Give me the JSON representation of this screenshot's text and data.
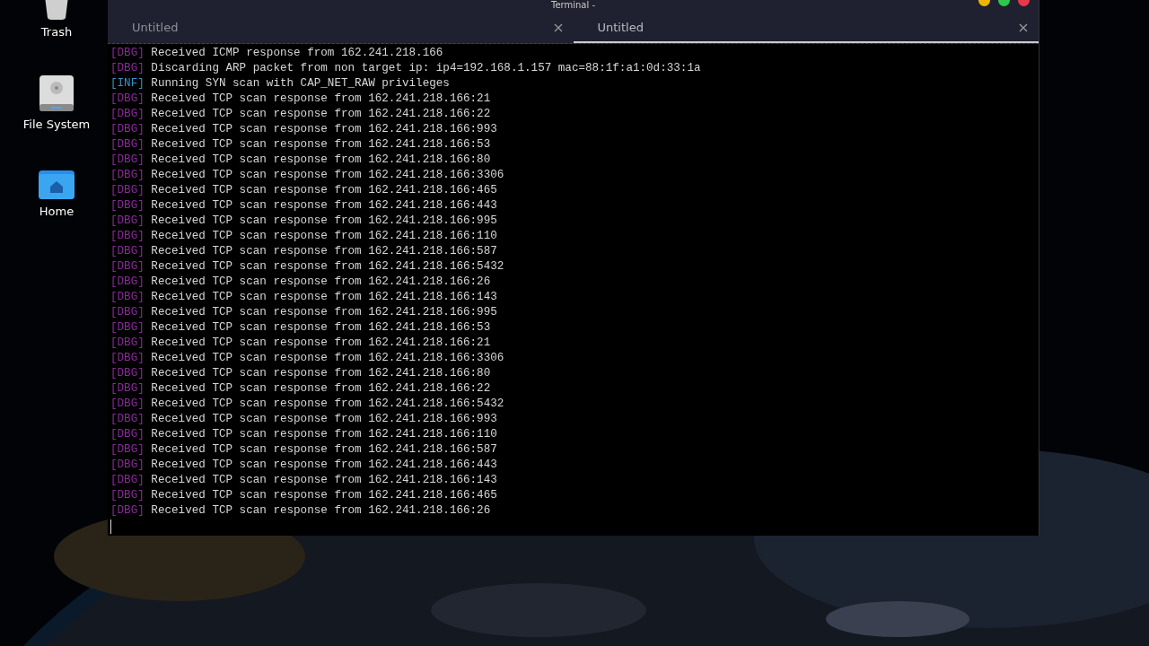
{
  "desktop_icons": [
    {
      "kind": "trash",
      "label": "Trash"
    },
    {
      "kind": "drive",
      "label": "File System"
    },
    {
      "kind": "home",
      "label": "Home"
    }
  ],
  "window": {
    "title": "Terminal -",
    "tabs": [
      {
        "label": "Untitled",
        "selected": false
      },
      {
        "label": "Untitled",
        "selected": true
      }
    ],
    "lines": [
      {
        "kind": "dbg",
        "tag": "[DBG]",
        "text": "Received ICMP response from 162.241.218.166"
      },
      {
        "kind": "dbg",
        "tag": "[DBG]",
        "text": "Discarding ARP packet from non target ip: ip4=192.168.1.157 mac=88:1f:a1:0d:33:1a"
      },
      {
        "kind": "inf",
        "tag": "[INF]",
        "text": "Running SYN scan with CAP_NET_RAW privileges"
      },
      {
        "kind": "dbg",
        "tag": "[DBG]",
        "text": "Received TCP scan response from 162.241.218.166:21"
      },
      {
        "kind": "dbg",
        "tag": "[DBG]",
        "text": "Received TCP scan response from 162.241.218.166:22"
      },
      {
        "kind": "dbg",
        "tag": "[DBG]",
        "text": "Received TCP scan response from 162.241.218.166:993"
      },
      {
        "kind": "dbg",
        "tag": "[DBG]",
        "text": "Received TCP scan response from 162.241.218.166:53"
      },
      {
        "kind": "dbg",
        "tag": "[DBG]",
        "text": "Received TCP scan response from 162.241.218.166:80"
      },
      {
        "kind": "dbg",
        "tag": "[DBG]",
        "text": "Received TCP scan response from 162.241.218.166:3306"
      },
      {
        "kind": "dbg",
        "tag": "[DBG]",
        "text": "Received TCP scan response from 162.241.218.166:465"
      },
      {
        "kind": "dbg",
        "tag": "[DBG]",
        "text": "Received TCP scan response from 162.241.218.166:443"
      },
      {
        "kind": "dbg",
        "tag": "[DBG]",
        "text": "Received TCP scan response from 162.241.218.166:995"
      },
      {
        "kind": "dbg",
        "tag": "[DBG]",
        "text": "Received TCP scan response from 162.241.218.166:110"
      },
      {
        "kind": "dbg",
        "tag": "[DBG]",
        "text": "Received TCP scan response from 162.241.218.166:587"
      },
      {
        "kind": "dbg",
        "tag": "[DBG]",
        "text": "Received TCP scan response from 162.241.218.166:5432"
      },
      {
        "kind": "dbg",
        "tag": "[DBG]",
        "text": "Received TCP scan response from 162.241.218.166:26"
      },
      {
        "kind": "dbg",
        "tag": "[DBG]",
        "text": "Received TCP scan response from 162.241.218.166:143"
      },
      {
        "kind": "dbg",
        "tag": "[DBG]",
        "text": "Received TCP scan response from 162.241.218.166:995"
      },
      {
        "kind": "dbg",
        "tag": "[DBG]",
        "text": "Received TCP scan response from 162.241.218.166:53"
      },
      {
        "kind": "dbg",
        "tag": "[DBG]",
        "text": "Received TCP scan response from 162.241.218.166:21"
      },
      {
        "kind": "dbg",
        "tag": "[DBG]",
        "text": "Received TCP scan response from 162.241.218.166:3306"
      },
      {
        "kind": "dbg",
        "tag": "[DBG]",
        "text": "Received TCP scan response from 162.241.218.166:80"
      },
      {
        "kind": "dbg",
        "tag": "[DBG]",
        "text": "Received TCP scan response from 162.241.218.166:22"
      },
      {
        "kind": "dbg",
        "tag": "[DBG]",
        "text": "Received TCP scan response from 162.241.218.166:5432"
      },
      {
        "kind": "dbg",
        "tag": "[DBG]",
        "text": "Received TCP scan response from 162.241.218.166:993"
      },
      {
        "kind": "dbg",
        "tag": "[DBG]",
        "text": "Received TCP scan response from 162.241.218.166:110"
      },
      {
        "kind": "dbg",
        "tag": "[DBG]",
        "text": "Received TCP scan response from 162.241.218.166:587"
      },
      {
        "kind": "dbg",
        "tag": "[DBG]",
        "text": "Received TCP scan response from 162.241.218.166:443"
      },
      {
        "kind": "dbg",
        "tag": "[DBG]",
        "text": "Received TCP scan response from 162.241.218.166:143"
      },
      {
        "kind": "dbg",
        "tag": "[DBG]",
        "text": "Received TCP scan response from 162.241.218.166:465"
      },
      {
        "kind": "dbg",
        "tag": "[DBG]",
        "text": "Received TCP scan response from 162.241.218.166:26"
      }
    ]
  }
}
